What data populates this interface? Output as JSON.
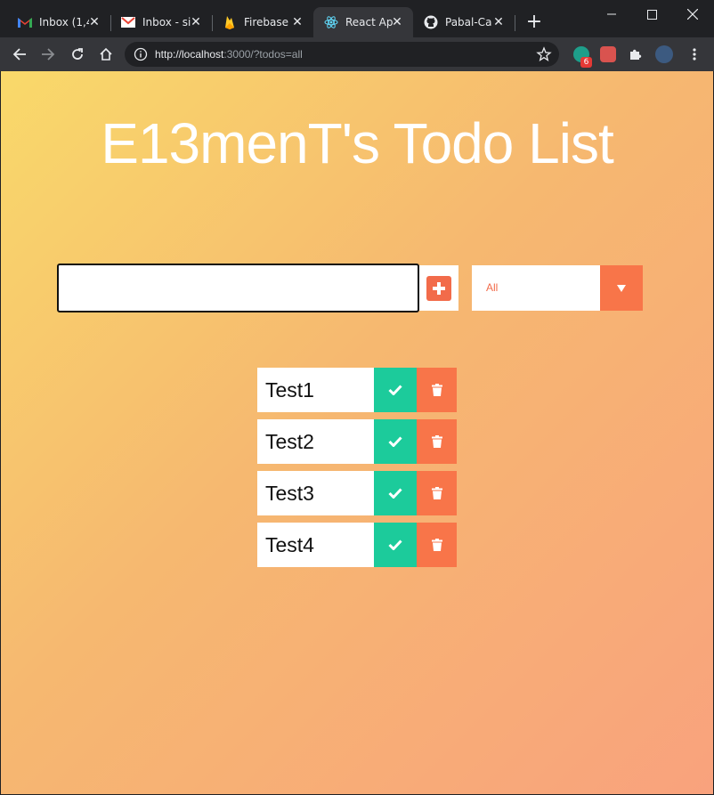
{
  "browser": {
    "tabs": [
      {
        "title": "Inbox (1,4",
        "icon": "gmail-icon"
      },
      {
        "title": "Inbox - si",
        "icon": "gmail-icon"
      },
      {
        "title": "Firebase",
        "icon": "firebase-icon"
      },
      {
        "title": "React Ap",
        "icon": "react-icon",
        "active": true
      },
      {
        "title": "Pabal-Ca",
        "icon": "github-icon"
      }
    ],
    "url_host": "http://localhost",
    "url_rest": ":3000/?todos=all",
    "extension_badge": "6"
  },
  "page": {
    "title": "E13menT's Todo List",
    "input_value": "",
    "filter": {
      "selected": "All"
    },
    "todos": [
      {
        "text": "Test1"
      },
      {
        "text": "Test2"
      },
      {
        "text": "Test3"
      },
      {
        "text": "Test4"
      }
    ]
  },
  "colors": {
    "accent_orange": "#f87549",
    "complete_green": "#1ccb9b",
    "gradient_start": "#f9d96a",
    "gradient_end": "#f9a27d"
  }
}
